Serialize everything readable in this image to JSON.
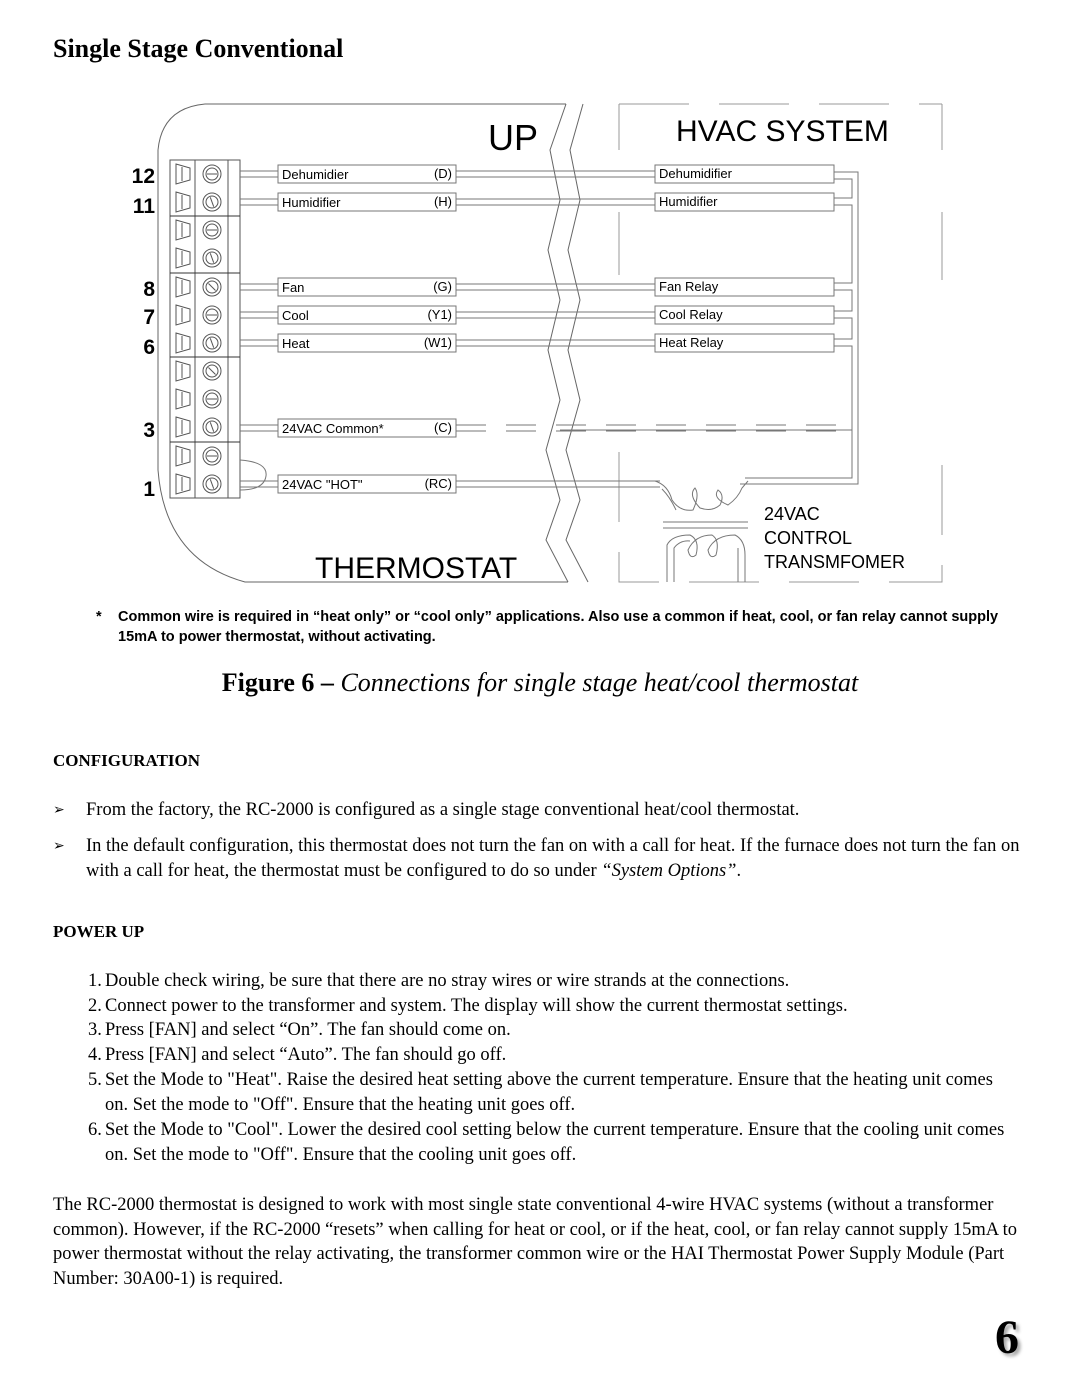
{
  "section_title": "Single Stage Conventional",
  "diagram": {
    "thermostat_title": "THERMOSTAT",
    "up_label": "UP",
    "hvac_title": "HVAC SYSTEM",
    "terminal_numbers": [
      "12",
      "11",
      "8",
      "7",
      "6",
      "3",
      "1"
    ],
    "wires": [
      {
        "label": "Dehumidier",
        "code": "(D)",
        "hvac_label": "Dehumidifier"
      },
      {
        "label": "Humidifier",
        "code": "(H)",
        "hvac_label": "Humidifier"
      },
      {
        "label": "Fan",
        "code": "(G)",
        "hvac_label": "Fan Relay"
      },
      {
        "label": "Cool",
        "code": "(Y1)",
        "hvac_label": "Cool Relay"
      },
      {
        "label": "Heat",
        "code": "(W1)",
        "hvac_label": "Heat Relay"
      },
      {
        "label": "24VAC Common*",
        "code": "(C)",
        "hvac_label": ""
      },
      {
        "label": "24VAC \"HOT\"",
        "code": "(RC)",
        "hvac_label": ""
      }
    ],
    "transformer_label": [
      "24VAC",
      "CONTROL",
      "TRANSMFOMER"
    ]
  },
  "footnote": {
    "marker": "*",
    "text": "Common wire is required in “heat only” or “cool only” applications.  Also use a common if heat, cool, or fan relay cannot supply 15mA to power thermostat, without activating."
  },
  "caption": {
    "label": "Figure 6 – ",
    "text": "Connections for single stage heat/cool thermostat"
  },
  "configuration": {
    "heading": "CONFIGURATION",
    "bullets": [
      {
        "text": "From the factory, the RC-2000 is configured as a single stage conventional heat/cool thermostat."
      },
      {
        "text": "In the default configuration, this thermostat does not turn the fan on with a call for heat.  If the furnace does not turn the fan on with a call for heat, the thermostat must be configured to do so under ",
        "emphasis": "“System Options”",
        "suffix": "."
      }
    ]
  },
  "power_up": {
    "heading": "POWER UP",
    "steps": [
      {
        "n": "1.",
        "text": "Double check wiring, be sure that there are no stray wires or wire strands at the connections."
      },
      {
        "n": "2.",
        "text": "Connect power to the transformer and system.  The display will show the current thermostat settings."
      },
      {
        "n": "3.",
        "text": "Press [FAN] and select “On”.  The fan should come on."
      },
      {
        "n": "4.",
        "text": "Press [FAN] and select “Auto”.  The fan should go off."
      },
      {
        "n": "5.",
        "text": "Set the Mode to \"Heat\".  Raise the desired heat setting above the current temperature.  Ensure that the heating unit comes on.  Set the mode to \"Off\".  Ensure that the heating unit goes off."
      },
      {
        "n": "6.",
        "text": "Set the Mode to \"Cool\".  Lower the desired cool setting below the current temperature.  Ensure that the cooling unit comes on.  Set the mode to \"Off\".  Ensure that the cooling unit goes off."
      }
    ]
  },
  "closing_paragraph": "The RC-2000 thermostat is designed to work with most single state conventional 4-wire HVAC systems (without a transformer common).  However, if the RC-2000 “resets” when calling for heat or cool, or if the heat, cool, or fan relay cannot supply 15mA to power thermostat without the relay activating, the transformer common wire or the HAI Thermostat Power Supply Module (Part Number: 30A00-1) is required.",
  "page_number": "6"
}
